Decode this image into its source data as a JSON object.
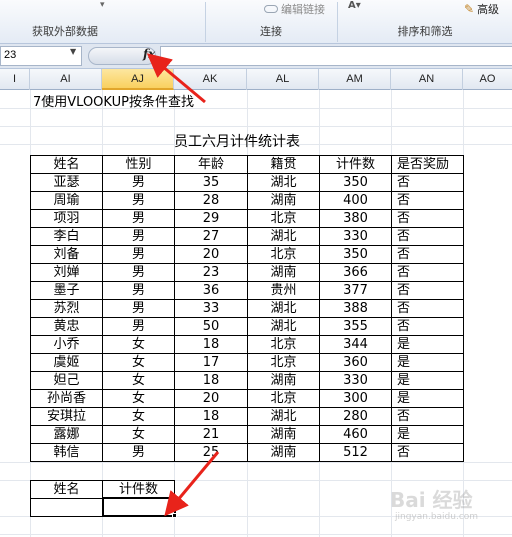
{
  "ribbon": {
    "groups": [
      {
        "label": "获取外部数据"
      },
      {
        "label": "连接",
        "button": "编辑链接"
      },
      {
        "label": "排序和筛选",
        "button": "高级"
      }
    ]
  },
  "formula_bar": {
    "name_box": "23",
    "fx": "fx",
    "value": ""
  },
  "columns": [
    "I",
    "AI",
    "AJ",
    "AK",
    "AL",
    "AM",
    "AN",
    "AO"
  ],
  "active_column": "AJ",
  "heading": "7使用VLOOKUP按条件查找",
  "table": {
    "title": "员工六月计件统计表",
    "headers": [
      "姓名",
      "性别",
      "年龄",
      "籍贯",
      "计件数",
      "是否奖励"
    ],
    "rows": [
      [
        "亚瑟",
        "男",
        "35",
        "湖北",
        "350",
        "否"
      ],
      [
        "周瑜",
        "男",
        "28",
        "湖南",
        "400",
        "否"
      ],
      [
        "项羽",
        "男",
        "29",
        "北京",
        "380",
        "否"
      ],
      [
        "李白",
        "男",
        "27",
        "湖北",
        "330",
        "否"
      ],
      [
        "刘备",
        "男",
        "20",
        "北京",
        "350",
        "否"
      ],
      [
        "刘婵",
        "男",
        "23",
        "湖南",
        "366",
        "否"
      ],
      [
        "墨子",
        "男",
        "36",
        "贵州",
        "377",
        "否"
      ],
      [
        "苏烈",
        "男",
        "33",
        "湖北",
        "388",
        "否"
      ],
      [
        "黄忠",
        "男",
        "50",
        "湖北",
        "355",
        "否"
      ],
      [
        "小乔",
        "女",
        "18",
        "北京",
        "344",
        "是"
      ],
      [
        "虞姬",
        "女",
        "17",
        "北京",
        "360",
        "是"
      ],
      [
        "妲己",
        "女",
        "18",
        "湖南",
        "330",
        "是"
      ],
      [
        "孙尚香",
        "女",
        "20",
        "北京",
        "300",
        "是"
      ],
      [
        "安琪拉",
        "女",
        "18",
        "湖北",
        "280",
        "否"
      ],
      [
        "露娜",
        "女",
        "21",
        "湖南",
        "460",
        "是"
      ],
      [
        "韩信",
        "男",
        "25",
        "湖南",
        "512",
        "否"
      ]
    ]
  },
  "lookup": {
    "headers": [
      "姓名",
      "计件数"
    ],
    "values": [
      "",
      ""
    ]
  },
  "watermark": {
    "text": "Bai 经验",
    "sub": "jingyan.baidu.com"
  },
  "colors": {
    "arrow": "#e8231b",
    "active_header": "#f9d05f"
  }
}
